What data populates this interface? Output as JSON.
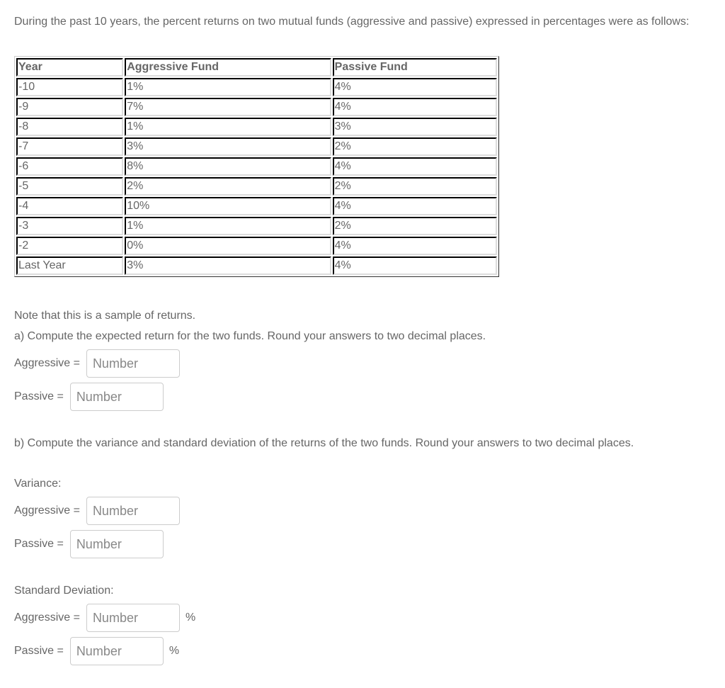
{
  "intro": "During the past 10 years, the percent returns on two mutual funds (aggressive and passive) expressed in percentages were as follows:",
  "table": {
    "headers": [
      "Year",
      "Aggressive Fund",
      "Passive Fund"
    ],
    "rows": [
      [
        "-10",
        "1%",
        "4%"
      ],
      [
        "-9",
        "7%",
        "4%"
      ],
      [
        "-8",
        "1%",
        "3%"
      ],
      [
        "-7",
        "3%",
        "2%"
      ],
      [
        "-6",
        "8%",
        "4%"
      ],
      [
        "-5",
        "2%",
        "2%"
      ],
      [
        "-4",
        "10%",
        "4%"
      ],
      [
        "-3",
        "1%",
        "2%"
      ],
      [
        "-2",
        "0%",
        "4%"
      ],
      [
        "Last Year",
        "3%",
        "4%"
      ]
    ]
  },
  "note": "Note that this is a sample of returns.",
  "part_a": {
    "prompt": "a) Compute the expected return for the two funds.  Round your answers to two decimal places.",
    "aggressive_label": "Aggressive =",
    "passive_label": "Passive =",
    "placeholder": "Number",
    "aggressive_value": "",
    "passive_value": ""
  },
  "part_b": {
    "prompt": "b) Compute the variance and standard deviation of the returns of the two funds.  Round your answers to two decimal places.",
    "variance_heading": "Variance:",
    "stddev_heading": "Standard Deviation:",
    "aggressive_label": "Aggressive =",
    "passive_label": "Passive =",
    "placeholder": "Number",
    "unit": "%",
    "variance_aggressive_value": "",
    "variance_passive_value": "",
    "stddev_aggressive_value": "",
    "stddev_passive_value": ""
  }
}
